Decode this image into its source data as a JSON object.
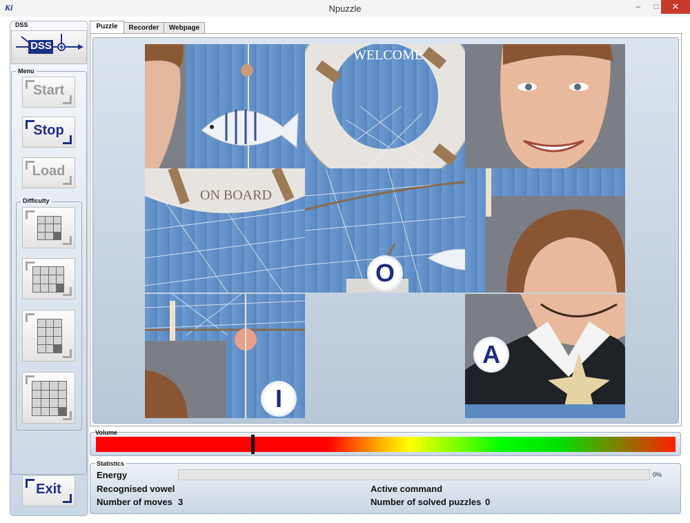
{
  "window": {
    "app_icon": "Ki",
    "title": "Npuzzle",
    "minimize": "–",
    "maximize": "□",
    "close": "✕"
  },
  "sidebar": {
    "dss_label": "DSS",
    "dss_logo_text": "DSS",
    "menu_label": "Menu",
    "start_label": "Start",
    "stop_label": "Stop",
    "load_label": "Load",
    "difficulty_label": "Difficulty",
    "difficulty_levels": [
      3,
      4,
      5,
      6
    ],
    "exit_label": "Exit"
  },
  "tabs": [
    "Puzzle",
    "Recorder",
    "Webpage"
  ],
  "puzzle": {
    "tile_texts": [
      "WELCOME",
      "ON BOARD"
    ],
    "vowels": [
      "O",
      "I",
      "A"
    ]
  },
  "volume": {
    "label": "Volume",
    "level": 0.27
  },
  "statistics": {
    "label": "Statistics",
    "energy_label": "Energy",
    "energy_value": 0,
    "energy_percent": "0%",
    "recognised_vowel_label": "Recognised vowel",
    "recognised_vowel_value": "",
    "active_command_label": "Active command",
    "active_command_value": "",
    "moves_label": "Number of moves",
    "moves_value": "3",
    "solved_label": "Number of solved puzzles",
    "solved_value": "0"
  }
}
